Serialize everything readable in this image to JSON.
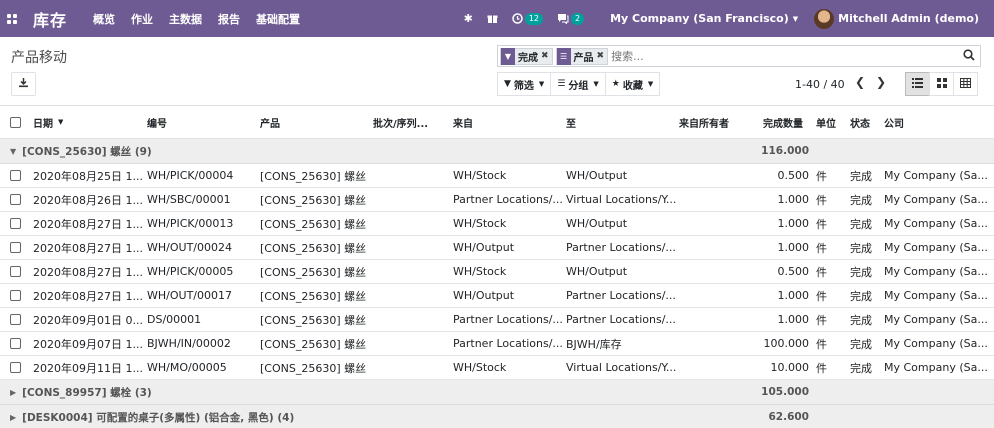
{
  "navbar": {
    "app_name": "库存",
    "menu": [
      "概览",
      "作业",
      "主数据",
      "报告",
      "基础配置"
    ],
    "activity_badge": "12",
    "messages_badge": "2",
    "company": "My Company (San Francisco)",
    "user": "Mitchell Admin (demo)",
    "accent_color": "#6f5b94"
  },
  "control": {
    "title": "产品移动",
    "facets": [
      {
        "icon": "filter-icon",
        "value": "完成"
      },
      {
        "icon": "group-by-icon",
        "value": "产品"
      }
    ],
    "search_placeholder": "搜索...",
    "filter_label": "筛选",
    "groupby_label": "分组",
    "favorites_label": "收藏",
    "pager": "1-40 / 40"
  },
  "table": {
    "columns": [
      "日期",
      "编号",
      "产品",
      "批次/序列...",
      "来自",
      "至",
      "来自所有者",
      "完成数量",
      "单位",
      "状态",
      "公司"
    ],
    "groups": [
      {
        "label": "[CONS_25630] 螺丝 (9)",
        "total": "116.000",
        "open": true,
        "rows": [
          {
            "date": "2020年08月25日 1...",
            "ref": "WH/PICK/00004",
            "product": "[CONS_25630] 螺丝",
            "lot": "",
            "from": "WH/Stock",
            "to": "WH/Output",
            "owner": "",
            "qty": "0.500",
            "uom": "件",
            "state": "完成",
            "company": "My Company (Sa..."
          },
          {
            "date": "2020年08月26日 1...",
            "ref": "WH/SBC/00001",
            "product": "[CONS_25630] 螺丝",
            "lot": "",
            "from": "Partner Locations/...",
            "to": "Virtual Locations/Y...",
            "owner": "",
            "qty": "1.000",
            "uom": "件",
            "state": "完成",
            "company": "My Company (Sa..."
          },
          {
            "date": "2020年08月27日 1...",
            "ref": "WH/PICK/00013",
            "product": "[CONS_25630] 螺丝",
            "lot": "",
            "from": "WH/Stock",
            "to": "WH/Output",
            "owner": "",
            "qty": "1.000",
            "uom": "件",
            "state": "完成",
            "company": "My Company (Sa..."
          },
          {
            "date": "2020年08月27日 1...",
            "ref": "WH/OUT/00024",
            "product": "[CONS_25630] 螺丝",
            "lot": "",
            "from": "WH/Output",
            "to": "Partner Locations/...",
            "owner": "",
            "qty": "1.000",
            "uom": "件",
            "state": "完成",
            "company": "My Company (Sa..."
          },
          {
            "date": "2020年08月27日 1...",
            "ref": "WH/PICK/00005",
            "product": "[CONS_25630] 螺丝",
            "lot": "",
            "from": "WH/Stock",
            "to": "WH/Output",
            "owner": "",
            "qty": "0.500",
            "uom": "件",
            "state": "完成",
            "company": "My Company (Sa..."
          },
          {
            "date": "2020年08月27日 1...",
            "ref": "WH/OUT/00017",
            "product": "[CONS_25630] 螺丝",
            "lot": "",
            "from": "WH/Output",
            "to": "Partner Locations/...",
            "owner": "",
            "qty": "1.000",
            "uom": "件",
            "state": "完成",
            "company": "My Company (Sa..."
          },
          {
            "date": "2020年09月01日 0...",
            "ref": "DS/00001",
            "product": "[CONS_25630] 螺丝",
            "lot": "",
            "from": "Partner Locations/...",
            "to": "Partner Locations/...",
            "owner": "",
            "qty": "1.000",
            "uom": "件",
            "state": "完成",
            "company": "My Company (Sa..."
          },
          {
            "date": "2020年09月07日 1...",
            "ref": "BJWH/IN/00002",
            "product": "[CONS_25630] 螺丝",
            "lot": "",
            "from": "Partner Locations/...",
            "to": "BJWH/库存",
            "owner": "",
            "qty": "100.000",
            "uom": "件",
            "state": "完成",
            "company": "My Company (Sa..."
          },
          {
            "date": "2020年09月11日 1...",
            "ref": "WH/MO/00005",
            "product": "[CONS_25630] 螺丝",
            "lot": "",
            "from": "WH/Stock",
            "to": "Virtual Locations/Y...",
            "owner": "",
            "qty": "10.000",
            "uom": "件",
            "state": "完成",
            "company": "My Company (Sa..."
          }
        ]
      },
      {
        "label": "[CONS_89957] 螺栓 (3)",
        "total": "105.000",
        "open": false,
        "rows": []
      },
      {
        "label": "[DESK0004] 可配置的桌子(多属性) (铝合金, 黑色) (4)",
        "total": "62.600",
        "open": false,
        "rows": []
      }
    ]
  }
}
